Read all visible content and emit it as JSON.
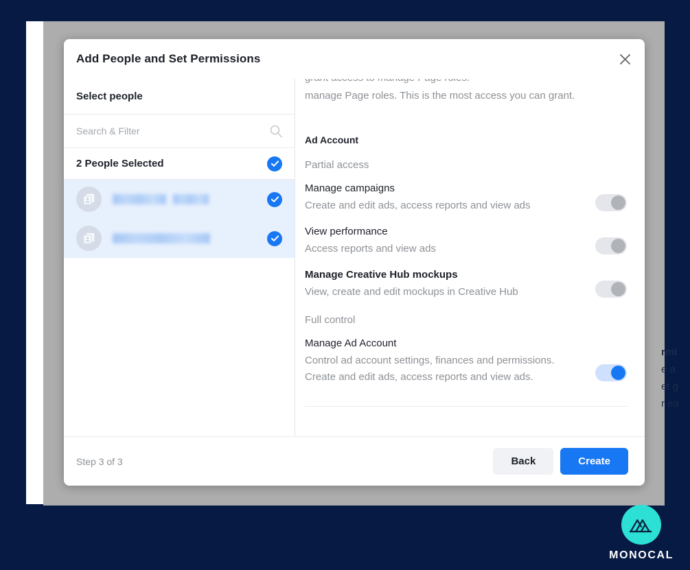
{
  "background": {
    "hidden_text_fragments": [
      "rmi",
      "e a",
      "et g",
      "r ea"
    ]
  },
  "modal": {
    "title": "Add People and Set Permissions",
    "close_icon": "close-icon",
    "left_panel": {
      "heading": "Select people",
      "search": {
        "placeholder": "Search & Filter",
        "value": "",
        "icon": "search-icon"
      },
      "selected_summary": "2 People Selected",
      "people": [
        {
          "name": "",
          "avatar_icon": "page-avatar-icon",
          "selected": true
        },
        {
          "name": "",
          "avatar_icon": "page-avatar-icon",
          "selected": true
        }
      ]
    },
    "right_panel": {
      "clipped_line": "grant access to manage Page roles.",
      "intro_text": "manage Page roles. This is the most access you can grant.",
      "section_title": "Ad Account",
      "groups": [
        {
          "label": "Partial access",
          "permissions": [
            {
              "title": "Manage campaigns",
              "bold": false,
              "description": "Create and edit ads, access reports and view ads",
              "enabled": false
            },
            {
              "title": "View performance",
              "bold": false,
              "description": "Access reports and view ads",
              "enabled": false
            },
            {
              "title": "Manage Creative Hub mockups",
              "bold": true,
              "description": "View, create and edit mockups in Creative Hub",
              "enabled": false
            }
          ]
        },
        {
          "label": "Full control",
          "permissions": [
            {
              "title": "Manage Ad Account",
              "bold": false,
              "description": "Control ad account settings, finances and permissions. Create and edit ads, access reports and view ads.",
              "enabled": true
            }
          ]
        }
      ]
    },
    "footer": {
      "step_text": "Step 3 of 3",
      "back_label": "Back",
      "create_label": "Create"
    }
  },
  "watermark": {
    "brand": "MONOCAL",
    "logo_icon": "monocal-mountain-icon",
    "accent_color": "#2ce0d5"
  },
  "colors": {
    "primary_blue": "#1877f2",
    "page_dark": "#061a44",
    "toggle_off_track": "#e4e6eb",
    "toggle_off_knob": "#b0b3b8",
    "selected_row_bg": "#e7f0fd"
  }
}
